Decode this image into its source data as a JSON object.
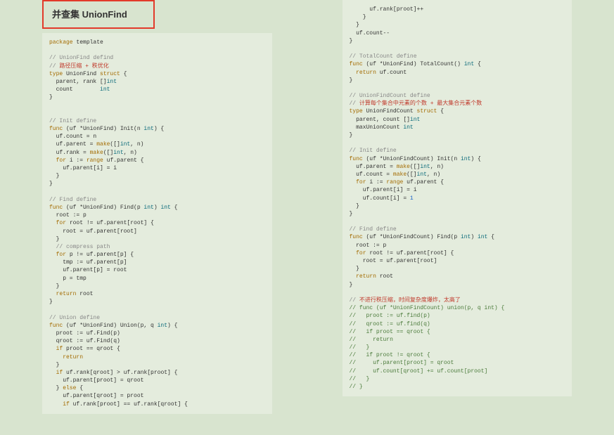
{
  "title": "并查集 UnionFind",
  "left_code_html": "<span class='c-keyword'>package</span> template\n\n<span class='c-comment'>// UnionFind defind</span>\n<span class='c-comment'>// </span><span class='c-zh-red'>路径压缩 + 秩优化</span>\n<span class='c-keyword'>type</span> UnionFind <span class='c-keyword'>struct</span> {\n  parent, rank []<span class='c-type'>int</span>\n  count        <span class='c-type'>int</span>\n}\n\n\n<span class='c-comment'>// Init define</span>\n<span class='c-keyword'>func</span> (uf *UnionFind) Init(n <span class='c-type'>int</span>) {\n  uf.count = n\n  uf.parent = <span class='c-keyword'>make</span>([]<span class='c-type'>int</span>, n)\n  uf.rank = <span class='c-keyword'>make</span>([]<span class='c-type'>int</span>, n)\n  <span class='c-keyword'>for</span> i := <span class='c-keyword'>range</span> uf.parent {\n    uf.parent[i] = i\n  }\n}\n\n<span class='c-comment'>// Find define</span>\n<span class='c-keyword'>func</span> (uf *UnionFind) Find(p <span class='c-type'>int</span>) <span class='c-type'>int</span> {\n  root := p\n  <span class='c-keyword'>for</span> root != uf.parent[root] {\n    root = uf.parent[root]\n  }\n  <span class='c-comment'>// compress path</span>\n  <span class='c-keyword'>for</span> p != uf.parent[p] {\n    tmp := uf.parent[p]\n    uf.parent[p] = root\n    p = tmp\n  }\n  <span class='c-keyword'>return</span> root\n}\n\n<span class='c-comment'>// Union define</span>\n<span class='c-keyword'>func</span> (uf *UnionFind) Union(p, q <span class='c-type'>int</span>) {\n  proot := uf.Find(p)\n  qroot := uf.Find(q)\n  <span class='c-keyword'>if</span> proot == qroot {\n    <span class='c-keyword'>return</span>\n  }\n  <span class='c-keyword'>if</span> uf.rank[qroot] &gt; uf.rank[proot] {\n    uf.parent[proot] = qroot\n  } <span class='c-keyword'>else</span> {\n    uf.parent[qroot] = proot\n    <span class='c-keyword'>if</span> uf.rank[proot] == uf.rank[qroot] {",
  "right_code_html": "      uf.rank[proot]++\n    }\n  }\n  uf.count--\n}\n\n<span class='c-comment'>// TotalCount define</span>\n<span class='c-keyword'>func</span> (uf *UnionFind) TotalCount() <span class='c-type'>int</span> {\n  <span class='c-keyword'>return</span> uf.count\n}\n\n<span class='c-comment'>// UnionFindCount define</span>\n<span class='c-comment'>// </span><span class='c-zh-red'>计算每个集合中元素的个数 + 最大集合元素个数</span>\n<span class='c-keyword'>type</span> UnionFindCount <span class='c-keyword'>struct</span> {\n  parent, count []<span class='c-type'>int</span>\n  maxUnionCount <span class='c-type'>int</span>\n}\n\n<span class='c-comment'>// Init define</span>\n<span class='c-keyword'>func</span> (uf *UnionFindCount) Init(n <span class='c-type'>int</span>) {\n  uf.parent = <span class='c-keyword'>make</span>([]<span class='c-type'>int</span>, n)\n  uf.count = <span class='c-keyword'>make</span>([]<span class='c-type'>int</span>, n)\n  <span class='c-keyword'>for</span> i := <span class='c-keyword'>range</span> uf.parent {\n    uf.parent[i] = i\n    uf.count[i] = <span class='c-num'>1</span>\n  }\n}\n\n<span class='c-comment'>// Find define</span>\n<span class='c-keyword'>func</span> (uf *UnionFindCount) Find(p <span class='c-type'>int</span>) <span class='c-type'>int</span> {\n  root := p\n  <span class='c-keyword'>for</span> root != uf.parent[root] {\n    root = uf.parent[root]\n  }\n  <span class='c-keyword'>return</span> root\n}\n\n<span class='c-comment'>// </span><span class='c-zh-red'>不进行秩压缩，时间复杂度爆炸，太高了</span>\n<span class='c-comment-green'>// func (uf *UnionFindCount) union(p, q int) {</span>\n<span class='c-comment-green'>//   proot := uf.find(p)</span>\n<span class='c-comment-green'>//   qroot := uf.find(q)</span>\n<span class='c-comment-green'>//   if proot == qroot {</span>\n<span class='c-comment-green'>//     return</span>\n<span class='c-comment-green'>//   }</span>\n<span class='c-comment-green'>//   if proot != qroot {</span>\n<span class='c-comment-green'>//     uf.parent[proot] = qroot</span>\n<span class='c-comment-green'>//     uf.count[qroot] += uf.count[proot]</span>\n<span class='c-comment-green'>//   }</span>\n<span class='c-comment-green'>// }</span>"
}
